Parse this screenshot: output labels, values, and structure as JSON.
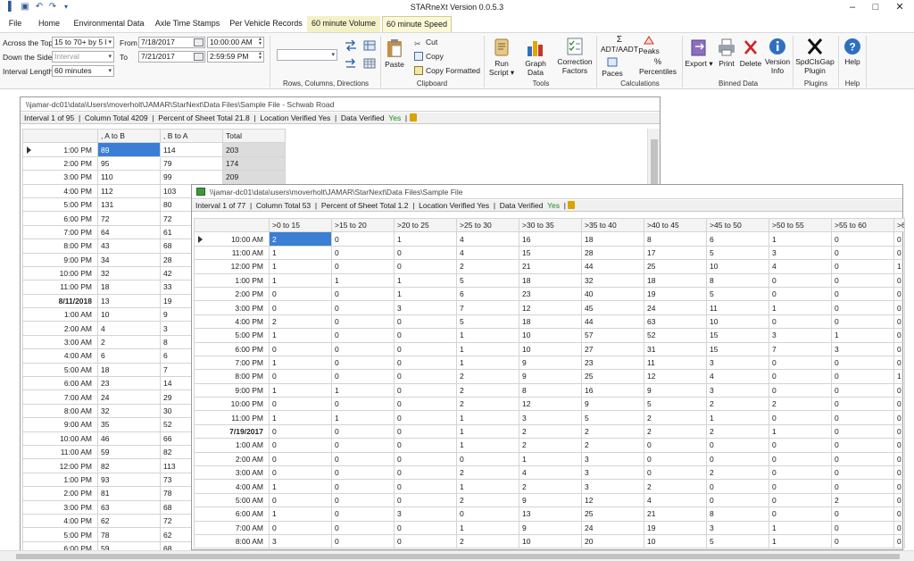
{
  "app": {
    "title": "STARneXt Version 0.0.5.3",
    "window_controls": [
      "–",
      "□",
      "✕"
    ]
  },
  "tabs": [
    "File",
    "Home",
    "Environmental Data",
    "Axle Time Stamps",
    "Per Vehicle Records",
    "60 minute Volume",
    "60 minute Speed"
  ],
  "ribbon": {
    "across_top_label": "Across the Top",
    "across_top_value": "15 to 70+ by 5 l",
    "down_side_label": "Down the Side",
    "down_side_value": "Interval",
    "interval_length_label": "Interval Length",
    "interval_length_value": "60 minutes",
    "from_label": "From",
    "from_date": "7/18/2017",
    "from_time": "10:00:00 AM",
    "to_label": "To",
    "to_date": "7/21/2017",
    "to_time": "2:59:59 PM",
    "groups": {
      "rcd": "Rows, Columns, Directions",
      "clipboard": "Clipboard",
      "tools": "Tools",
      "calculations": "Calculations",
      "binned": "Binned Data",
      "plugins": "Plugins",
      "help": "Help"
    },
    "buttons": {
      "paste": "Paste",
      "cut": "Cut",
      "copy": "Copy",
      "copy_formatted": "Copy Formatted",
      "run_script_1": "Run",
      "run_script_2": "Script ▾",
      "graph_data": "Graph Data",
      "correction_1": "Correction",
      "correction_2": "Factors",
      "adt": "ADT/AADT",
      "paces": "Paces",
      "peaks": "Peaks",
      "percentiles_sym": "%",
      "percentiles": "Percentiles",
      "export": "Export ▾",
      "print": "Print",
      "delete": "Delete",
      "version_1": "Version",
      "version_2": "Info",
      "plugin_1": "SpdClsGap",
      "plugin_2": "Plugin",
      "help": "Help"
    }
  },
  "volume_window": {
    "title": "\\\\jamar-dc01\\data\\Users\\moverholt\\JAMAR\\StarNext\\Data Files\\Sample File - Schwab Road",
    "status": {
      "interval": "Interval 1 of 95",
      "column_total": "Column Total  4209",
      "percent": "Percent of Sheet Total  21.8",
      "location_verified": "Location Verified  Yes",
      "data_verified_label": "Data Verified",
      "data_verified_value": "Yes"
    },
    "columns": [
      ", A to B",
      ", B to A",
      "Total"
    ],
    "rows": [
      {
        "label": "1:00 PM",
        "cells": [
          "89",
          "114",
          "203"
        ]
      },
      {
        "label": "2:00 PM",
        "cells": [
          "95",
          "79",
          "174"
        ]
      },
      {
        "label": "3:00 PM",
        "cells": [
          "110",
          "99",
          "209"
        ]
      },
      {
        "label": "4:00 PM",
        "cells": [
          "112",
          "103",
          ""
        ]
      },
      {
        "label": "5:00 PM",
        "cells": [
          "131",
          "80",
          ""
        ]
      },
      {
        "label": "6:00 PM",
        "cells": [
          "72",
          "72",
          ""
        ]
      },
      {
        "label": "7:00 PM",
        "cells": [
          "64",
          "61",
          ""
        ]
      },
      {
        "label": "8:00 PM",
        "cells": [
          "43",
          "68",
          ""
        ]
      },
      {
        "label": "9:00 PM",
        "cells": [
          "34",
          "28",
          ""
        ]
      },
      {
        "label": "10:00 PM",
        "cells": [
          "32",
          "42",
          ""
        ]
      },
      {
        "label": "11:00 PM",
        "cells": [
          "18",
          "33",
          ""
        ]
      },
      {
        "label": "8/11/2018",
        "cells": [
          "13",
          "19",
          ""
        ],
        "bold": true
      },
      {
        "label": "1:00 AM",
        "cells": [
          "10",
          "9",
          ""
        ]
      },
      {
        "label": "2:00 AM",
        "cells": [
          "4",
          "3",
          ""
        ]
      },
      {
        "label": "3:00 AM",
        "cells": [
          "2",
          "8",
          ""
        ]
      },
      {
        "label": "4:00 AM",
        "cells": [
          "6",
          "6",
          ""
        ]
      },
      {
        "label": "5:00 AM",
        "cells": [
          "18",
          "7",
          ""
        ]
      },
      {
        "label": "6:00 AM",
        "cells": [
          "23",
          "14",
          ""
        ]
      },
      {
        "label": "7:00 AM",
        "cells": [
          "24",
          "29",
          ""
        ]
      },
      {
        "label": "8:00 AM",
        "cells": [
          "32",
          "30",
          ""
        ]
      },
      {
        "label": "9:00 AM",
        "cells": [
          "35",
          "52",
          ""
        ]
      },
      {
        "label": "10:00 AM",
        "cells": [
          "46",
          "66",
          ""
        ]
      },
      {
        "label": "11:00 AM",
        "cells": [
          "59",
          "82",
          ""
        ]
      },
      {
        "label": "12:00 PM",
        "cells": [
          "82",
          "113",
          ""
        ]
      },
      {
        "label": "1:00 PM",
        "cells": [
          "93",
          "73",
          ""
        ]
      },
      {
        "label": "2:00 PM",
        "cells": [
          "81",
          "78",
          ""
        ]
      },
      {
        "label": "3:00 PM",
        "cells": [
          "63",
          "68",
          ""
        ]
      },
      {
        "label": "4:00 PM",
        "cells": [
          "62",
          "72",
          ""
        ]
      },
      {
        "label": "5:00 PM",
        "cells": [
          "78",
          "62",
          ""
        ]
      },
      {
        "label": "6:00 PM",
        "cells": [
          "59",
          "68",
          ""
        ]
      }
    ]
  },
  "speed_window": {
    "title": "\\\\jamar-dc01\\data\\users\\moverholt\\JAMAR\\StarNext\\Data Files\\Sample File",
    "status": {
      "interval": "Interval 1 of 77",
      "column_total": "Column Total  53",
      "percent": "Percent of Sheet Total  1.2",
      "location_verified": "Location Verified  Yes",
      "data_verified_label": "Data Verified",
      "data_verified_value": "Yes"
    },
    "columns": [
      ">0 to 15",
      ">15 to 20",
      ">20 to 25",
      ">25 to 30",
      ">30 to 35",
      ">35 to 40",
      ">40 to 45",
      ">45 to 50",
      ">50 to 55",
      ">55 to 60",
      ">6"
    ],
    "rows": [
      {
        "label": "10:00 AM",
        "cells": [
          "2",
          "0",
          "1",
          "4",
          "16",
          "18",
          "8",
          "6",
          "1",
          "0",
          "0"
        ]
      },
      {
        "label": "11:00 AM",
        "cells": [
          "1",
          "0",
          "0",
          "4",
          "15",
          "28",
          "17",
          "5",
          "3",
          "0",
          "0"
        ]
      },
      {
        "label": "12:00 PM",
        "cells": [
          "1",
          "0",
          "0",
          "2",
          "21",
          "44",
          "25",
          "10",
          "4",
          "0",
          "1"
        ]
      },
      {
        "label": "1:00 PM",
        "cells": [
          "1",
          "1",
          "1",
          "5",
          "18",
          "32",
          "18",
          "8",
          "0",
          "0",
          "0"
        ]
      },
      {
        "label": "2:00 PM",
        "cells": [
          "0",
          "0",
          "1",
          "6",
          "23",
          "40",
          "19",
          "5",
          "0",
          "0",
          "0"
        ]
      },
      {
        "label": "3:00 PM",
        "cells": [
          "0",
          "0",
          "3",
          "7",
          "12",
          "45",
          "24",
          "11",
          "1",
          "0",
          "0"
        ]
      },
      {
        "label": "4:00 PM",
        "cells": [
          "2",
          "0",
          "0",
          "5",
          "18",
          "44",
          "63",
          "10",
          "0",
          "0",
          "0"
        ]
      },
      {
        "label": "5:00 PM",
        "cells": [
          "1",
          "0",
          "0",
          "1",
          "10",
          "57",
          "52",
          "15",
          "3",
          "1",
          "0"
        ]
      },
      {
        "label": "6:00 PM",
        "cells": [
          "0",
          "0",
          "0",
          "1",
          "10",
          "27",
          "31",
          "15",
          "7",
          "3",
          "0"
        ]
      },
      {
        "label": "7:00 PM",
        "cells": [
          "1",
          "0",
          "0",
          "1",
          "9",
          "23",
          "11",
          "3",
          "0",
          "0",
          "0"
        ]
      },
      {
        "label": "8:00 PM",
        "cells": [
          "0",
          "0",
          "0",
          "2",
          "9",
          "25",
          "12",
          "4",
          "0",
          "0",
          "1"
        ]
      },
      {
        "label": "9:00 PM",
        "cells": [
          "1",
          "1",
          "0",
          "2",
          "8",
          "16",
          "9",
          "3",
          "0",
          "0",
          "0"
        ]
      },
      {
        "label": "10:00 PM",
        "cells": [
          "0",
          "0",
          "0",
          "2",
          "12",
          "9",
          "5",
          "2",
          "2",
          "0",
          "0"
        ]
      },
      {
        "label": "11:00 PM",
        "cells": [
          "1",
          "1",
          "0",
          "1",
          "3",
          "5",
          "2",
          "1",
          "0",
          "0",
          "0"
        ]
      },
      {
        "label": "7/19/2017",
        "cells": [
          "0",
          "0",
          "0",
          "1",
          "2",
          "2",
          "2",
          "2",
          "1",
          "0",
          "0"
        ],
        "bold": true
      },
      {
        "label": "1:00 AM",
        "cells": [
          "0",
          "0",
          "0",
          "1",
          "2",
          "2",
          "0",
          "0",
          "0",
          "0",
          "0"
        ]
      },
      {
        "label": "2:00 AM",
        "cells": [
          "0",
          "0",
          "0",
          "0",
          "1",
          "3",
          "0",
          "0",
          "0",
          "0",
          "0"
        ]
      },
      {
        "label": "3:00 AM",
        "cells": [
          "0",
          "0",
          "0",
          "2",
          "4",
          "3",
          "0",
          "2",
          "0",
          "0",
          "0"
        ]
      },
      {
        "label": "4:00 AM",
        "cells": [
          "1",
          "0",
          "0",
          "1",
          "2",
          "3",
          "2",
          "0",
          "0",
          "0",
          "0"
        ]
      },
      {
        "label": "5:00 AM",
        "cells": [
          "0",
          "0",
          "0",
          "2",
          "9",
          "12",
          "4",
          "0",
          "0",
          "2",
          "0"
        ]
      },
      {
        "label": "6:00 AM",
        "cells": [
          "1",
          "0",
          "3",
          "0",
          "13",
          "25",
          "21",
          "8",
          "0",
          "0",
          "0"
        ]
      },
      {
        "label": "7:00 AM",
        "cells": [
          "0",
          "0",
          "0",
          "1",
          "9",
          "24",
          "19",
          "3",
          "1",
          "0",
          "0"
        ]
      },
      {
        "label": "8:00 AM",
        "cells": [
          "3",
          "0",
          "0",
          "2",
          "10",
          "20",
          "10",
          "5",
          "1",
          "0",
          "0"
        ]
      }
    ]
  }
}
